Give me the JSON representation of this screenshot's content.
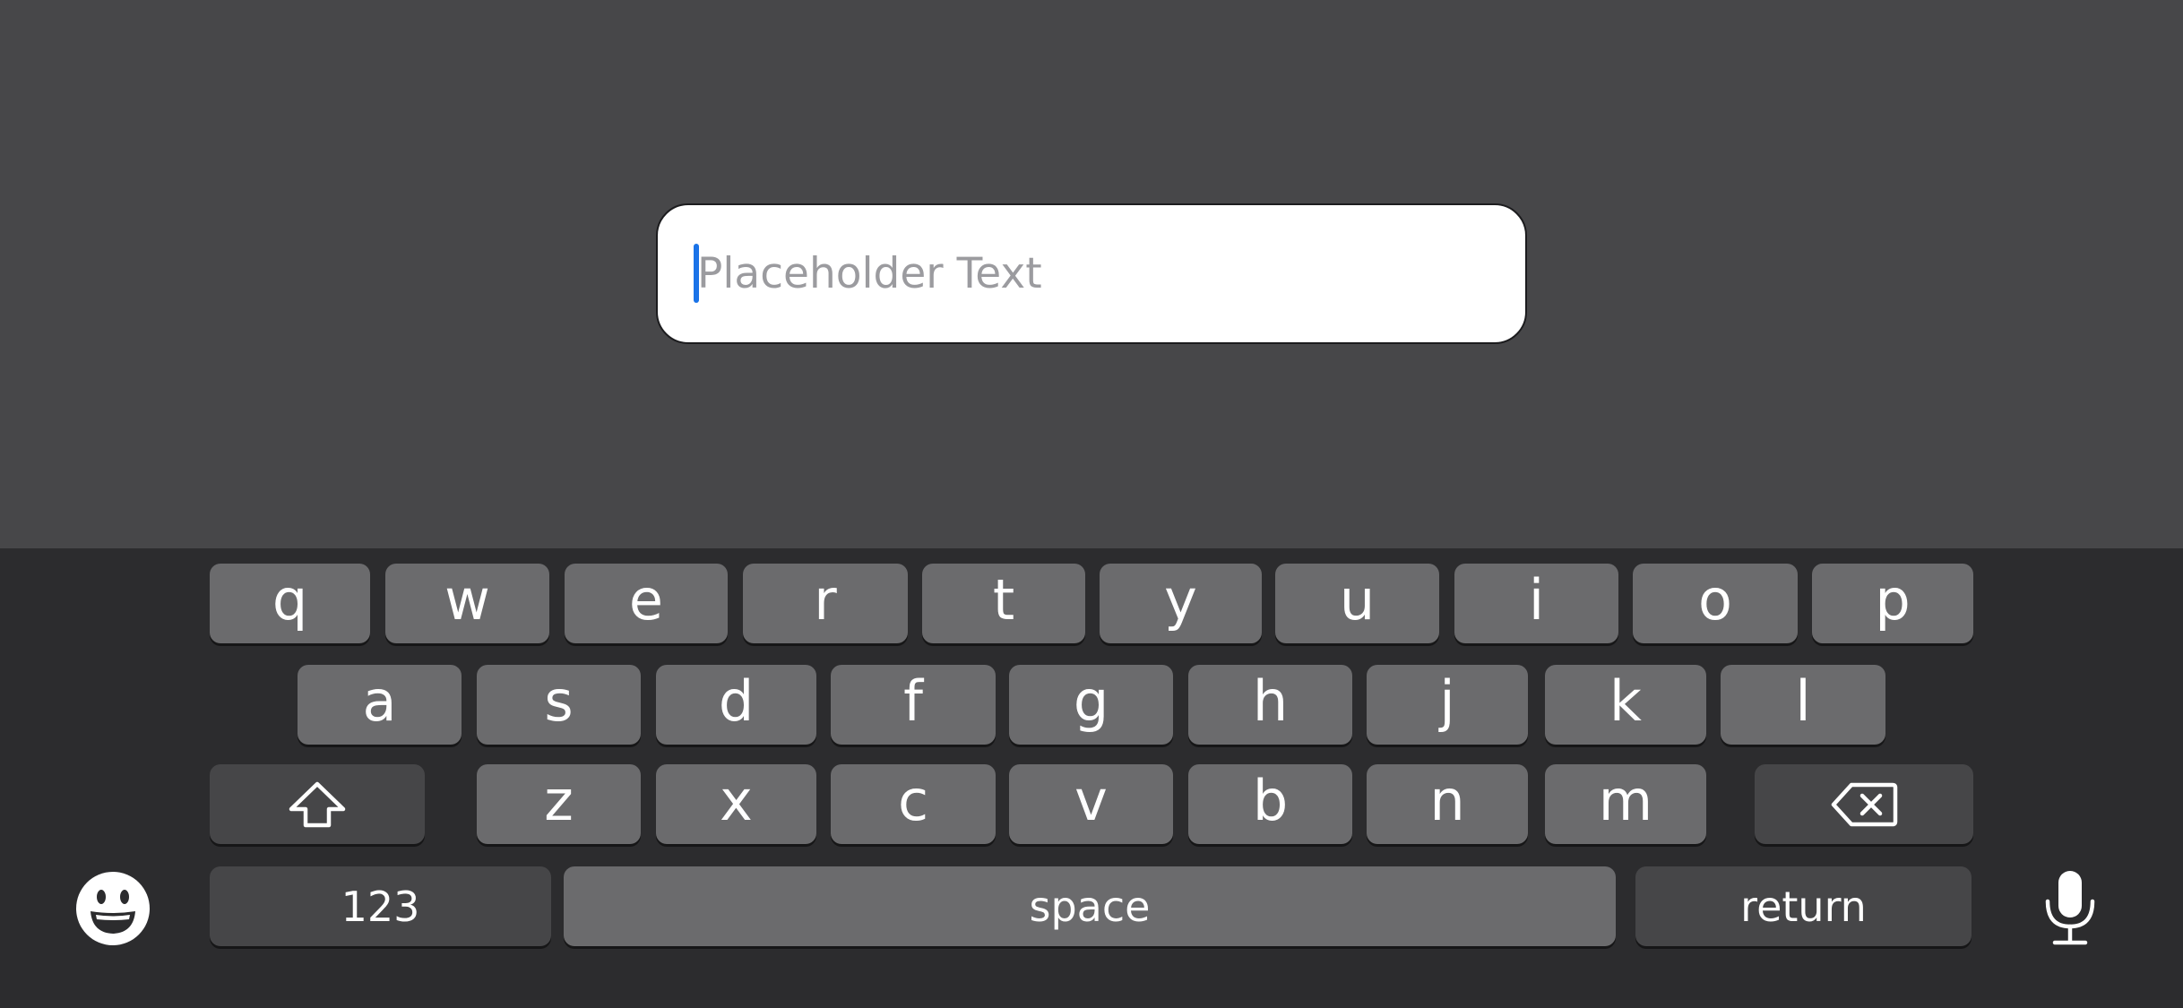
{
  "text_field": {
    "placeholder": "Placeholder Text"
  },
  "keyboard": {
    "row1": [
      "q",
      "w",
      "e",
      "r",
      "t",
      "y",
      "u",
      "i",
      "o",
      "p"
    ],
    "row2": [
      "a",
      "s",
      "d",
      "f",
      "g",
      "h",
      "j",
      "k",
      "l"
    ],
    "row3": [
      "z",
      "x",
      "c",
      "v",
      "b",
      "n",
      "m"
    ],
    "numbers_label": "123",
    "space_label": "space",
    "return_label": "return",
    "icons": {
      "shift": "shift-arrow-icon",
      "delete": "backspace-icon",
      "emoji": "emoji-icon",
      "dictation": "microphone-icon"
    }
  },
  "colors": {
    "caret": "#1a73e8",
    "key_light": "#6b6b6d",
    "key_dark": "#464648",
    "keyboard_bg": "#2c2c2e",
    "app_bg": "#474749"
  }
}
